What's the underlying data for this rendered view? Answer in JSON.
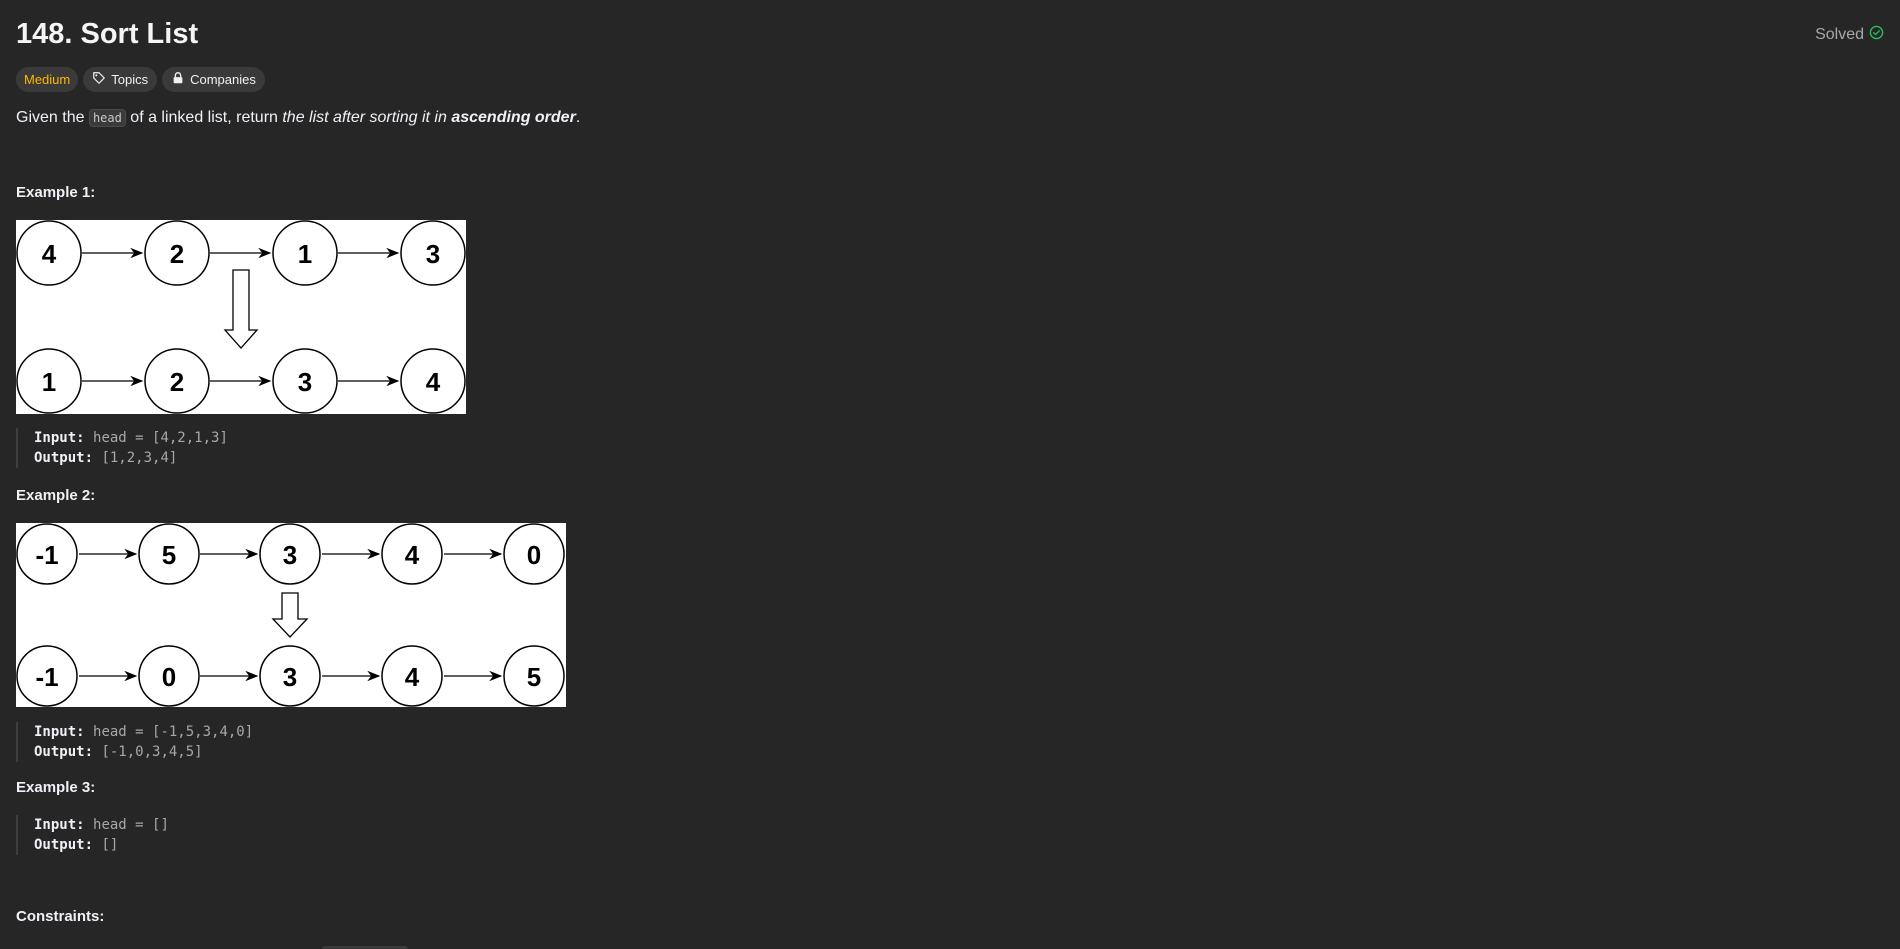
{
  "problem": {
    "title": "148. Sort List",
    "status": "Solved",
    "difficulty": "Medium",
    "topics_label": "Topics",
    "companies_label": "Companies"
  },
  "description": {
    "part1": "Given the ",
    "code": "head",
    "part2": " of a linked list, return ",
    "italic": "the list after sorting it in ",
    "bold": "ascending order",
    "end": "."
  },
  "examples": [
    {
      "title": "Example 1:",
      "input_label": "Input:",
      "input": "head = [4,2,1,3]",
      "output_label": "Output:",
      "output": "[1,2,3,4]",
      "diagram": {
        "before": [
          "4",
          "2",
          "1",
          "3"
        ],
        "after": [
          "1",
          "2",
          "3",
          "4"
        ]
      }
    },
    {
      "title": "Example 2:",
      "input_label": "Input:",
      "input": "head = [-1,5,3,4,0]",
      "output_label": "Output:",
      "output": "[-1,0,3,4,5]",
      "diagram": {
        "before": [
          "-1",
          "5",
          "3",
          "4",
          "0"
        ],
        "after": [
          "-1",
          "0",
          "3",
          "4",
          "5"
        ]
      }
    },
    {
      "title": "Example 3:",
      "input_label": "Input:",
      "input": "head = []",
      "output_label": "Output:",
      "output": "[]"
    }
  ],
  "constraints_title": "Constraints:",
  "colors": {
    "background": "#262626",
    "difficulty_medium": "#ffb800",
    "solved_check": "#2cbb5d"
  },
  "icons": {
    "solved": "check-circle-icon",
    "topics": "tag-icon",
    "companies": "lock-icon"
  }
}
